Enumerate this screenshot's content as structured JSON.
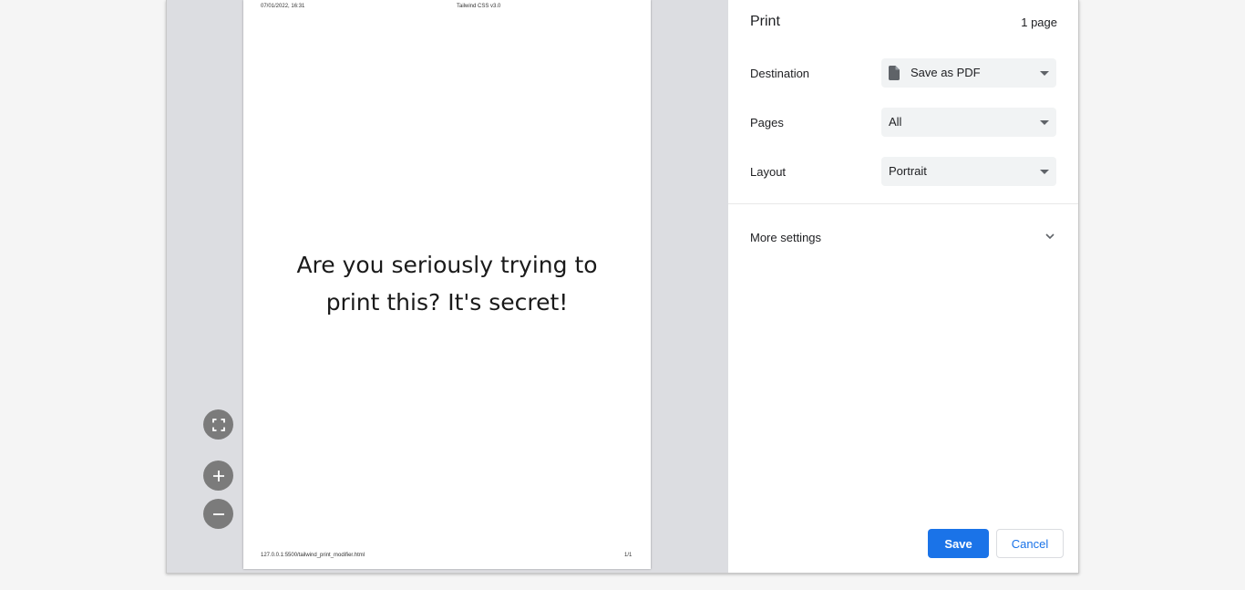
{
  "preview": {
    "header_date": "07/01/2022, 16:31",
    "header_title": "Tailwind CSS v3.0",
    "body_line1": "Are you seriously trying to",
    "body_line2": "print this? It's secret!",
    "footer_url": "127.0.0.1:5500/tailwind_print_modifier.html",
    "footer_page": "1/1",
    "zoom_controls": [
      "fit-to-page-icon",
      "zoom-in-icon",
      "zoom-out-icon"
    ]
  },
  "settings": {
    "title": "Print",
    "page_count": "1 page",
    "destination": {
      "label": "Destination",
      "value": "Save as PDF",
      "icon": "document-icon"
    },
    "pages": {
      "label": "Pages",
      "value": "All"
    },
    "layout": {
      "label": "Layout",
      "value": "Portrait"
    },
    "more_settings": {
      "label": "More settings",
      "icon": "chevron-down-icon"
    },
    "save_label": "Save",
    "cancel_label": "Cancel"
  },
  "colors": {
    "accent": "#1a73e8",
    "preview_background": "#dcdde1",
    "select_background": "#f1f3f4",
    "zoom_button": "#7b7b7b"
  }
}
